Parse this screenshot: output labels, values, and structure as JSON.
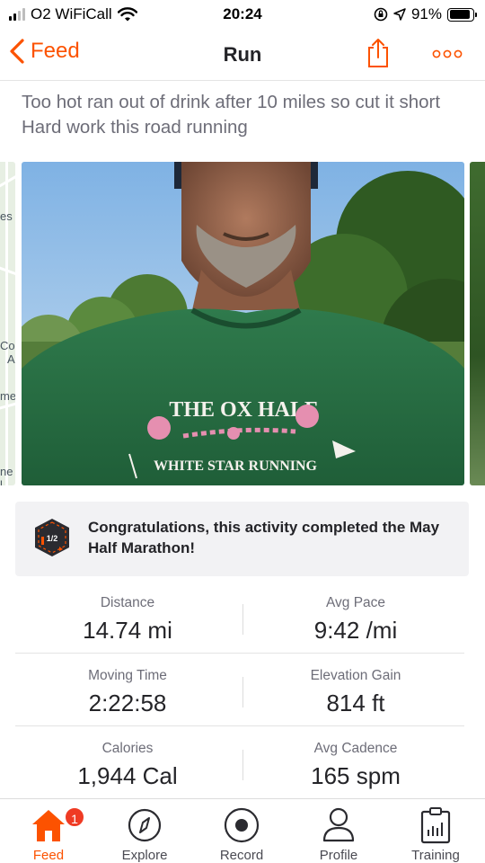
{
  "status_bar": {
    "carrier": "O2 WiFiCall",
    "time": "20:24",
    "battery_percent": "91%",
    "battery_level": 0.91
  },
  "navbar": {
    "back_label": "Feed",
    "title": "Run",
    "share_icon": "share-icon",
    "more_icon": "more-icon"
  },
  "description": {
    "line1": "Too hot ran out of drink after 10 miles so cut it short",
    "line2": "Hard work this road running"
  },
  "photo": {
    "shirt_text_top": "THE OX HALF",
    "shirt_text_bottom": "WHITE STAR RUNNING"
  },
  "map_peek": {
    "labels": [
      "es",
      "Co",
      "A",
      "mel",
      "ne l"
    ]
  },
  "achievement": {
    "badge_text": "1/2",
    "text": "Congratulations, this activity completed the May Half Marathon!"
  },
  "stats": [
    {
      "left": {
        "label": "Distance",
        "value": "14.74 mi"
      },
      "right": {
        "label": "Avg Pace",
        "value": "9:42 /mi"
      }
    },
    {
      "left": {
        "label": "Moving Time",
        "value": "2:22:58"
      },
      "right": {
        "label": "Elevation Gain",
        "value": "814 ft"
      }
    },
    {
      "left": {
        "label": "Calories",
        "value": "1,944 Cal"
      },
      "right": {
        "label": "Avg Cadence",
        "value": "165 spm"
      }
    }
  ],
  "tabbar": {
    "feed": "Feed",
    "feed_badge": "1",
    "explore": "Explore",
    "record": "Record",
    "profile": "Profile",
    "training": "Training"
  },
  "colors": {
    "accent": "#fc5200",
    "badge": "#ef3b24"
  }
}
